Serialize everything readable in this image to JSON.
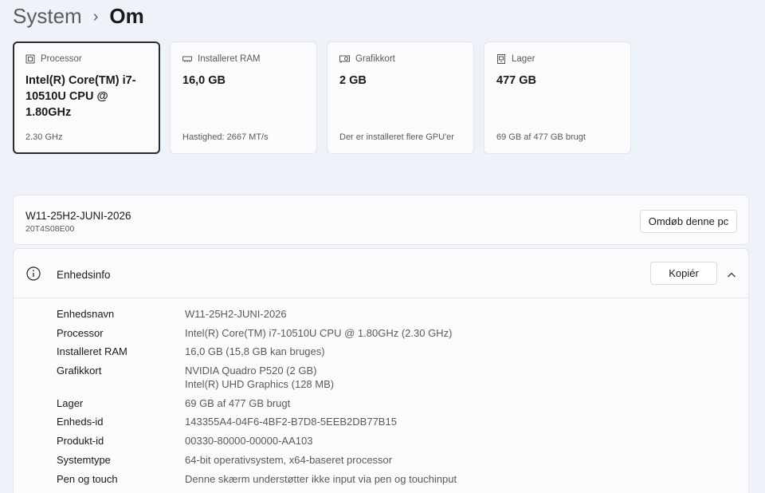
{
  "breadcrumb": {
    "parent": "System",
    "separator": "›",
    "current": "Om"
  },
  "cards": [
    {
      "icon": "processor-icon",
      "label": "Processor",
      "value": "Intel(R) Core(TM) i7-10510U CPU @ 1.80GHz",
      "sub": "2.30 GHz",
      "selected": true
    },
    {
      "icon": "ram-icon",
      "label": "Installeret RAM",
      "value": "16,0 GB",
      "sub": "Hastighed: 2667 MT/s",
      "selected": false
    },
    {
      "icon": "graphics-card-icon",
      "label": "Grafikkort",
      "value": "2 GB",
      "sub": "Der er installeret flere GPU'er",
      "selected": false
    },
    {
      "icon": "storage-icon",
      "label": "Lager",
      "value": "477 GB",
      "sub": "69 GB af 477 GB brugt",
      "selected": false
    }
  ],
  "pc": {
    "name": "W11-25H2-JUNI-2026",
    "model": "20T4S08E00",
    "rename_label": "Omdøb denne pc"
  },
  "device_info": {
    "title": "Enhedsinfo",
    "copy_label": "Kopiér",
    "specs": [
      {
        "label": "Enhedsnavn",
        "value": "W11-25H2-JUNI-2026"
      },
      {
        "label": "Processor",
        "value": "Intel(R) Core(TM) i7-10510U CPU @ 1.80GHz (2.30 GHz)"
      },
      {
        "label": "Installeret RAM",
        "value": "16,0 GB (15,8 GB kan bruges)"
      },
      {
        "label": "Grafikkort",
        "value": "NVIDIA Quadro P520 (2 GB)",
        "value2": "Intel(R) UHD Graphics (128 MB)"
      },
      {
        "label": "Lager",
        "value": "69 GB af 477 GB brugt"
      },
      {
        "label": "Enheds-id",
        "value": "143355A4-04F6-4BF2-B7D8-5EEB2DB77B15"
      },
      {
        "label": "Produkt-id",
        "value": "00330-80000-00000-AA103"
      },
      {
        "label": "Systemtype",
        "value": "64-bit operativsystem, x64-baseret processor"
      },
      {
        "label": "Pen og touch",
        "value": "Denne skærm understøtter ikke input via pen og touchinput"
      }
    ]
  }
}
